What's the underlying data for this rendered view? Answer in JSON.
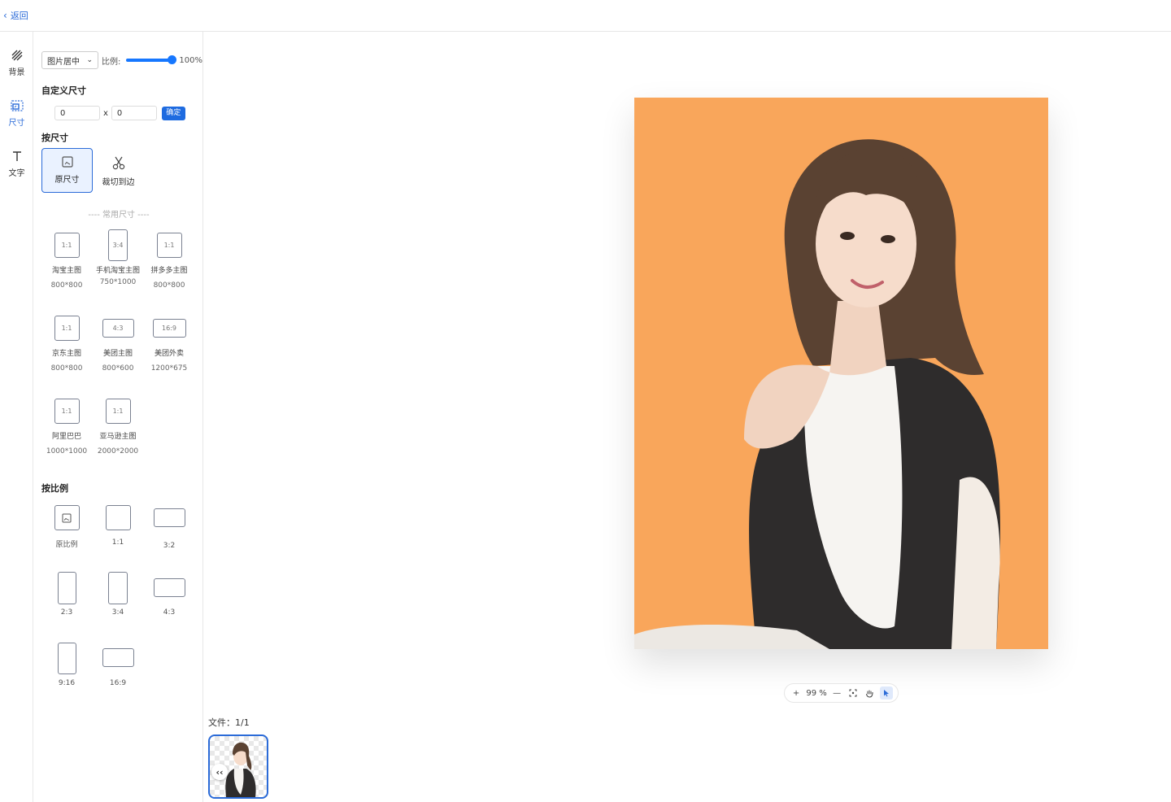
{
  "topbar": {
    "back_label": "返回"
  },
  "rail": {
    "items": [
      {
        "label": "背景",
        "icon": "hatch-icon"
      },
      {
        "label": "尺寸",
        "icon": "resize-icon",
        "active": true
      },
      {
        "label": "文字",
        "icon": "text-icon"
      }
    ]
  },
  "panel": {
    "align_select": "图片居中",
    "ratio_label": "比例:",
    "ratio_value": "100%",
    "ratio_level": 1.0,
    "custom_title": "自定义尺寸",
    "width_value": "0",
    "height_value": "0",
    "times": "x",
    "confirm_label": "确定",
    "by_size_title": "按尺寸",
    "modes": [
      {
        "label": "原尺寸",
        "active": true
      },
      {
        "label": "裁切到边",
        "active": false
      }
    ],
    "common_label": "---- 常用尺寸 ----",
    "sizes": [
      {
        "ratio": "1:1",
        "name": "淘宝主图",
        "dim": "800*800"
      },
      {
        "ratio": "3:4",
        "name": "手机淘宝主图",
        "dim": "750*1000"
      },
      {
        "ratio": "1:1",
        "name": "拼多多主图",
        "dim": "800*800"
      },
      {
        "ratio": "1:1",
        "name": "京东主图",
        "dim": "800*800"
      },
      {
        "ratio": "4:3",
        "name": "美团主图",
        "dim": "800*600"
      },
      {
        "ratio": "16:9",
        "name": "美团外卖",
        "dim": "1200*675"
      },
      {
        "ratio": "1:1",
        "name": "阿里巴巴",
        "dim": "1000*1000"
      },
      {
        "ratio": "1:1",
        "name": "亚马逊主图",
        "dim": "2000*2000"
      }
    ],
    "by_ratio_title": "按比例",
    "ratios": [
      {
        "label": "原比例"
      },
      {
        "label": "1:1"
      },
      {
        "label": "3:2"
      },
      {
        "label": "2:3"
      },
      {
        "label": "3:4"
      },
      {
        "label": "4:3"
      },
      {
        "label": "9:16"
      },
      {
        "label": "16:9"
      }
    ]
  },
  "canvas": {
    "background_color": "#f9a65b",
    "zoom": "99 %",
    "files_label": "文件：1/1",
    "collapse_label": "‹‹"
  }
}
